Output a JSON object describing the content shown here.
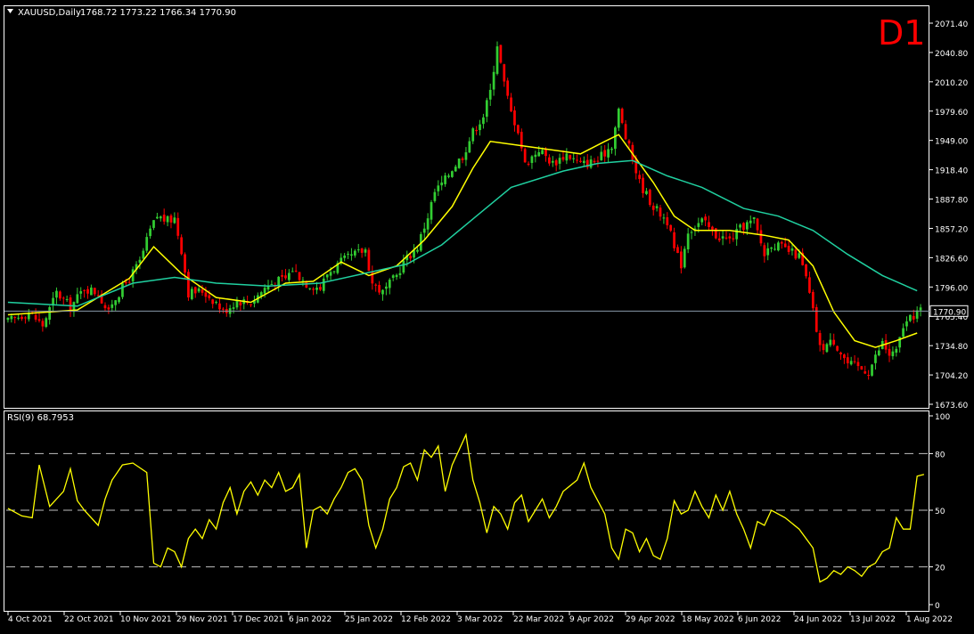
{
  "header": {
    "title": "XAUUSD,Daily",
    "ohlc": "1768.72 1773.22 1766.34 1770.90",
    "timeframe_badge": "D1"
  },
  "rsi_panel": {
    "label": "RSI(9) 68.7953"
  },
  "colors": {
    "background": "#000000",
    "bull": "#32cd32",
    "bear": "#ff0000",
    "ma_fast": "#ffff00",
    "ma_slow": "#20d0a0",
    "rsi": "#ffff00",
    "price_line": "#8899aa",
    "grid": "#ffffff",
    "text": "#ffffff",
    "badge": "#ff0000"
  },
  "chart_data": [
    {
      "type": "candlestick",
      "symbol": "XAUUSD",
      "timeframe": "Daily",
      "current_price": "1770.90",
      "y_ticks": [
        "2071.40",
        "2040.80",
        "2010.20",
        "1979.60",
        "1949.00",
        "1918.40",
        "1887.80",
        "1857.20",
        "1826.60",
        "1796.00",
        "1765.40",
        "1734.80",
        "1704.20",
        "1673.60"
      ],
      "ylim": [
        1673.6,
        2071.4
      ],
      "x_labels": [
        "4 Oct 2021",
        "22 Oct 2021",
        "10 Nov 2021",
        "29 Nov 2021",
        "17 Dec 2021",
        "6 Jan 2022",
        "25 Jan 2022",
        "12 Feb 2022",
        "3 Mar 2022",
        "22 Mar 2022",
        "9 Apr 2022",
        "29 Apr 2022",
        "18 May 2022",
        "6 Jun 2022",
        "24 Jun 2022",
        "13 Jul 2022",
        "1 Aug 2022"
      ],
      "close_path": [
        [
          0,
          1760
        ],
        [
          6,
          1770
        ],
        [
          10,
          1756
        ],
        [
          14,
          1790
        ],
        [
          18,
          1775
        ],
        [
          22,
          1795
        ],
        [
          26,
          1790
        ],
        [
          29,
          1768
        ],
        [
          30,
          1780
        ],
        [
          34,
          1800
        ],
        [
          38,
          1822
        ],
        [
          41,
          1855
        ],
        [
          43,
          1870
        ],
        [
          46,
          1865
        ],
        [
          48,
          1868
        ],
        [
          50,
          1835
        ],
        [
          52,
          1790
        ],
        [
          56,
          1792
        ],
        [
          60,
          1780
        ],
        [
          62,
          1770
        ],
        [
          66,
          1782
        ],
        [
          70,
          1780
        ],
        [
          74,
          1795
        ],
        [
          76,
          1800
        ],
        [
          80,
          1805
        ],
        [
          82,
          1815
        ],
        [
          86,
          1800
        ],
        [
          90,
          1795
        ],
        [
          92,
          1810
        ],
        [
          96,
          1822
        ],
        [
          100,
          1830
        ],
        [
          103,
          1835
        ],
        [
          105,
          1800
        ],
        [
          108,
          1790
        ],
        [
          112,
          1808
        ],
        [
          114,
          1822
        ],
        [
          118,
          1838
        ],
        [
          121,
          1870
        ],
        [
          123,
          1895
        ],
        [
          126,
          1908
        ],
        [
          128,
          1920
        ],
        [
          131,
          1933
        ],
        [
          134,
          1958
        ],
        [
          137,
          1975
        ],
        [
          139,
          2000
        ],
        [
          141,
          2050
        ],
        [
          143,
          2008
        ],
        [
          145,
          1978
        ],
        [
          147,
          1960
        ],
        [
          149,
          1924
        ],
        [
          153,
          1940
        ],
        [
          157,
          1925
        ],
        [
          161,
          1935
        ],
        [
          165,
          1924
        ],
        [
          170,
          1928
        ],
        [
          174,
          1945
        ],
        [
          176,
          1980
        ],
        [
          178,
          1952
        ],
        [
          180,
          1930
        ],
        [
          182,
          1905
        ],
        [
          186,
          1880
        ],
        [
          190,
          1865
        ],
        [
          192,
          1835
        ],
        [
          194,
          1820
        ],
        [
          196,
          1855
        ],
        [
          200,
          1865
        ],
        [
          204,
          1850
        ],
        [
          208,
          1845
        ],
        [
          212,
          1860
        ],
        [
          215,
          1865
        ],
        [
          218,
          1830
        ],
        [
          220,
          1842
        ],
        [
          224,
          1835
        ],
        [
          228,
          1828
        ],
        [
          230,
          1805
        ],
        [
          232,
          1770
        ],
        [
          234,
          1732
        ],
        [
          238,
          1740
        ],
        [
          242,
          1716
        ],
        [
          245,
          1712
        ],
        [
          248,
          1708
        ],
        [
          252,
          1738
        ],
        [
          254,
          1725
        ],
        [
          256,
          1728
        ],
        [
          258,
          1755
        ],
        [
          260,
          1762
        ],
        [
          262,
          1770.9
        ]
      ],
      "series": [
        {
          "name": "MA fast",
          "values": [
            [
              0,
              1767
            ],
            [
              20,
              1772
            ],
            [
              35,
              1805
            ],
            [
              42,
              1838
            ],
            [
              50,
              1810
            ],
            [
              60,
              1785
            ],
            [
              70,
              1780
            ],
            [
              80,
              1800
            ],
            [
              88,
              1802
            ],
            [
              96,
              1822
            ],
            [
              104,
              1808
            ],
            [
              112,
              1818
            ],
            [
              120,
              1845
            ],
            [
              128,
              1880
            ],
            [
              134,
              1920
            ],
            [
              139,
              1948
            ],
            [
              145,
              1945
            ],
            [
              155,
              1940
            ],
            [
              165,
              1935
            ],
            [
              172,
              1948
            ],
            [
              176,
              1955
            ],
            [
              180,
              1935
            ],
            [
              186,
              1905
            ],
            [
              192,
              1870
            ],
            [
              198,
              1855
            ],
            [
              208,
              1855
            ],
            [
              218,
              1850
            ],
            [
              225,
              1845
            ],
            [
              232,
              1818
            ],
            [
              238,
              1770
            ],
            [
              244,
              1740
            ],
            [
              250,
              1733
            ],
            [
              256,
              1740
            ],
            [
              262,
              1748
            ]
          ]
        },
        {
          "name": "MA slow",
          "values": [
            [
              0,
              1780
            ],
            [
              20,
              1776
            ],
            [
              36,
              1800
            ],
            [
              48,
              1806
            ],
            [
              60,
              1800
            ],
            [
              75,
              1797
            ],
            [
              90,
              1800
            ],
            [
              105,
              1812
            ],
            [
              115,
              1820
            ],
            [
              125,
              1840
            ],
            [
              135,
              1870
            ],
            [
              145,
              1900
            ],
            [
              160,
              1917
            ],
            [
              170,
              1925
            ],
            [
              180,
              1928
            ],
            [
              190,
              1912
            ],
            [
              200,
              1900
            ],
            [
              212,
              1878
            ],
            [
              222,
              1870
            ],
            [
              232,
              1855
            ],
            [
              242,
              1830
            ],
            [
              252,
              1808
            ],
            [
              262,
              1792
            ]
          ]
        }
      ]
    },
    {
      "type": "line",
      "name": "RSI(9)",
      "ylim": [
        0,
        100
      ],
      "y_ticks": [
        "100",
        "80",
        "50",
        "20",
        "0"
      ],
      "levels": [
        80,
        50,
        20
      ],
      "values": [
        [
          0,
          51
        ],
        [
          4,
          47
        ],
        [
          7,
          46
        ],
        [
          9,
          74
        ],
        [
          12,
          52
        ],
        [
          16,
          60
        ],
        [
          18,
          72
        ],
        [
          20,
          55
        ],
        [
          22,
          50
        ],
        [
          26,
          42
        ],
        [
          28,
          56
        ],
        [
          30,
          66
        ],
        [
          33,
          74
        ],
        [
          36,
          75
        ],
        [
          40,
          70
        ],
        [
          42,
          22
        ],
        [
          44,
          20
        ],
        [
          46,
          30
        ],
        [
          48,
          28
        ],
        [
          50,
          20
        ],
        [
          52,
          35
        ],
        [
          54,
          40
        ],
        [
          56,
          35
        ],
        [
          58,
          45
        ],
        [
          60,
          40
        ],
        [
          62,
          54
        ],
        [
          64,
          62
        ],
        [
          66,
          48
        ],
        [
          68,
          60
        ],
        [
          70,
          65
        ],
        [
          72,
          58
        ],
        [
          74,
          66
        ],
        [
          76,
          62
        ],
        [
          78,
          70
        ],
        [
          80,
          60
        ],
        [
          82,
          62
        ],
        [
          84,
          69
        ],
        [
          86,
          30
        ],
        [
          88,
          50
        ],
        [
          90,
          52
        ],
        [
          92,
          48
        ],
        [
          94,
          56
        ],
        [
          96,
          62
        ],
        [
          98,
          70
        ],
        [
          100,
          72
        ],
        [
          102,
          66
        ],
        [
          104,
          42
        ],
        [
          106,
          30
        ],
        [
          108,
          40
        ],
        [
          110,
          56
        ],
        [
          112,
          62
        ],
        [
          114,
          73
        ],
        [
          116,
          75
        ],
        [
          118,
          66
        ],
        [
          120,
          82
        ],
        [
          122,
          78
        ],
        [
          124,
          84
        ],
        [
          126,
          60
        ],
        [
          128,
          74
        ],
        [
          130,
          82
        ],
        [
          132,
          90
        ],
        [
          134,
          66
        ],
        [
          136,
          54
        ],
        [
          138,
          38
        ],
        [
          140,
          52
        ],
        [
          142,
          48
        ],
        [
          144,
          40
        ],
        [
          146,
          54
        ],
        [
          148,
          58
        ],
        [
          150,
          44
        ],
        [
          152,
          50
        ],
        [
          154,
          56
        ],
        [
          156,
          46
        ],
        [
          158,
          52
        ],
        [
          160,
          60
        ],
        [
          164,
          66
        ],
        [
          166,
          75
        ],
        [
          168,
          62
        ],
        [
          170,
          55
        ],
        [
          172,
          48
        ],
        [
          174,
          30
        ],
        [
          176,
          24
        ],
        [
          178,
          40
        ],
        [
          180,
          38
        ],
        [
          182,
          28
        ],
        [
          184,
          35
        ],
        [
          186,
          26
        ],
        [
          188,
          24
        ],
        [
          190,
          35
        ],
        [
          192,
          55
        ],
        [
          194,
          48
        ],
        [
          196,
          50
        ],
        [
          198,
          60
        ],
        [
          200,
          52
        ],
        [
          202,
          46
        ],
        [
          204,
          58
        ],
        [
          206,
          50
        ],
        [
          208,
          60
        ],
        [
          210,
          48
        ],
        [
          212,
          40
        ],
        [
          214,
          30
        ],
        [
          216,
          44
        ],
        [
          218,
          42
        ],
        [
          220,
          50
        ],
        [
          224,
          46
        ],
        [
          228,
          40
        ],
        [
          232,
          30
        ],
        [
          234,
          12
        ],
        [
          236,
          14
        ],
        [
          238,
          18
        ],
        [
          240,
          16
        ],
        [
          242,
          20
        ],
        [
          244,
          18
        ],
        [
          246,
          15
        ],
        [
          248,
          20
        ],
        [
          250,
          22
        ],
        [
          252,
          28
        ],
        [
          254,
          30
        ],
        [
          256,
          46
        ],
        [
          258,
          40
        ],
        [
          260,
          40
        ],
        [
          262,
          68
        ],
        [
          264,
          69
        ]
      ]
    }
  ]
}
